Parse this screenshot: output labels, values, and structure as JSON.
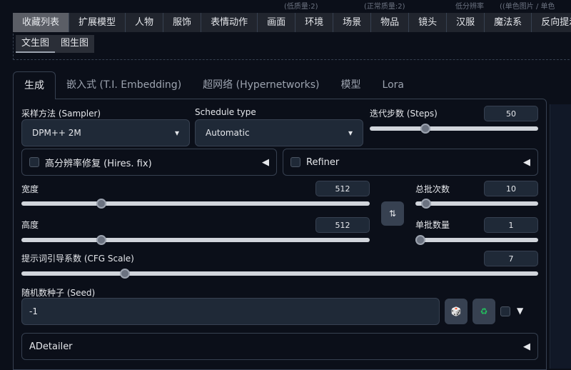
{
  "top_hints": [
    "(低质量:2)",
    "(正常质量:2)",
    "低分辨率",
    "((单色图片 / 单色"
  ],
  "tabs": [
    "收藏列表",
    "扩展模型",
    "人物",
    "服饰",
    "表情动作",
    "画面",
    "环境",
    "场景",
    "物品",
    "镜头",
    "汉服",
    "魔法系",
    "反向提示"
  ],
  "subtabs": [
    "文生图",
    "图生图"
  ],
  "main_tabs": [
    "生成",
    "嵌入式 (T.I. Embedding)",
    "超网络 (Hypernetworks)",
    "模型",
    "Lora"
  ],
  "sampler": {
    "label": "采样方法 (Sampler)",
    "value": "DPM++ 2M"
  },
  "schedule": {
    "label": "Schedule type",
    "value": "Automatic"
  },
  "steps": {
    "label": "迭代步数 (Steps)",
    "value": "50",
    "fraction": 0.33
  },
  "hires": {
    "label": "高分辨率修复 (Hires. fix)"
  },
  "refiner": {
    "label": "Refiner"
  },
  "width": {
    "label": "宽度",
    "value": "512",
    "fraction": 0.23
  },
  "height": {
    "label": "高度",
    "value": "512",
    "fraction": 0.23
  },
  "batch_count": {
    "label": "总批次数",
    "value": "10",
    "fraction": 0.09
  },
  "batch_size": {
    "label": "单批数量",
    "value": "1",
    "fraction": 0.0
  },
  "cfg": {
    "label": "提示词引导系数 (CFG Scale)",
    "value": "7",
    "fraction": 0.2
  },
  "seed": {
    "label": "随机数种子 (Seed)",
    "value": "-1"
  },
  "adetailer": {
    "label": "ADetailer"
  },
  "colors": {
    "accent": "#22c55e"
  }
}
